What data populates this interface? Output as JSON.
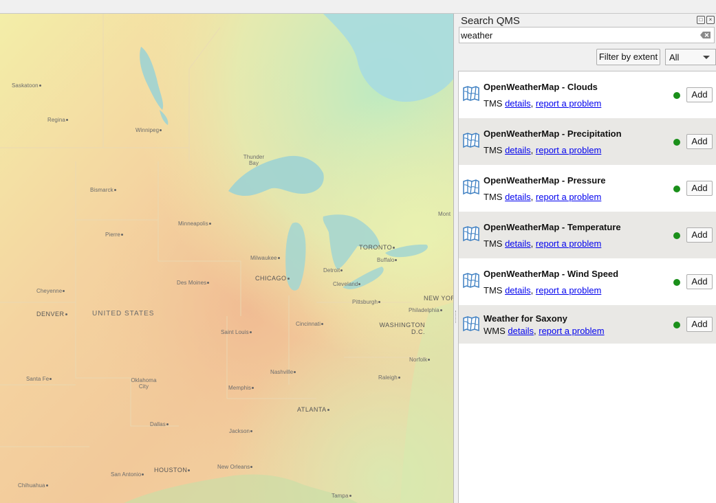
{
  "panel": {
    "title": "Search QMS",
    "search_value": "weather",
    "filter_label": "Filter by extent",
    "type_filter": "All"
  },
  "results": [
    {
      "name": "OpenWeatherMap - Clouds",
      "type": "TMS",
      "details": "details",
      "sep": ",",
      "report": "report a problem",
      "status": "ok",
      "add": "Add"
    },
    {
      "name": "OpenWeatherMap - Precipitation",
      "type": "TMS",
      "details": "details",
      "sep": ",",
      "report": "report a problem",
      "status": "ok",
      "add": "Add"
    },
    {
      "name": "OpenWeatherMap - Pressure",
      "type": "TMS",
      "details": "details",
      "sep": ",",
      "report": "report a problem",
      "status": "ok",
      "add": "Add"
    },
    {
      "name": "OpenWeatherMap - Temperature",
      "type": "TMS",
      "details": "details",
      "sep": ",",
      "report": "report a problem",
      "status": "ok",
      "add": "Add"
    },
    {
      "name": "OpenWeatherMap - Wind Speed",
      "type": "TMS",
      "details": "details",
      "sep": ",",
      "report": "report a problem",
      "status": "ok",
      "add": "Add"
    },
    {
      "name": "Weather for Saxony",
      "type": "WMS",
      "details": "details",
      "sep": ",",
      "report": "report a problem",
      "status": "ok",
      "add": "Add"
    }
  ],
  "map": {
    "labels": [
      {
        "text": "Saskatoon",
        "cls": "city"
      },
      {
        "text": "Regina",
        "cls": "city"
      },
      {
        "text": "Winnipeg",
        "cls": "city"
      },
      {
        "text": "Thunder Bay",
        "cls": "city"
      },
      {
        "text": "Bismarck",
        "cls": "city"
      },
      {
        "text": "Pierre",
        "cls": "city"
      },
      {
        "text": "Minneapolis",
        "cls": "city"
      },
      {
        "text": "Milwaukee",
        "cls": "city"
      },
      {
        "text": "CHICAGO",
        "cls": "big"
      },
      {
        "text": "Detroit",
        "cls": "city"
      },
      {
        "text": "TORONTO",
        "cls": "big"
      },
      {
        "text": "Buffalo",
        "cls": "city"
      },
      {
        "text": "Mont",
        "cls": "city"
      },
      {
        "text": "Cleveland",
        "cls": "city"
      },
      {
        "text": "Pittsburgh",
        "cls": "city"
      },
      {
        "text": "NEW YOR",
        "cls": "big"
      },
      {
        "text": "Philadelphia",
        "cls": "city"
      },
      {
        "text": "Cheyenne",
        "cls": "city"
      },
      {
        "text": "Des Moines",
        "cls": "city"
      },
      {
        "text": "DENVER",
        "cls": "big"
      },
      {
        "text": "UNITED STATES",
        "cls": "country"
      },
      {
        "text": "Cincinnati",
        "cls": "city"
      },
      {
        "text": "WASHINGTON D.C.",
        "cls": "big"
      },
      {
        "text": "Saint Louis",
        "cls": "city"
      },
      {
        "text": "Norfolk",
        "cls": "city"
      },
      {
        "text": "Nashville",
        "cls": "city"
      },
      {
        "text": "Raleigh",
        "cls": "city"
      },
      {
        "text": "Santa Fe",
        "cls": "city"
      },
      {
        "text": "Oklahoma City",
        "cls": "city"
      },
      {
        "text": "Memphis",
        "cls": "city"
      },
      {
        "text": "ATLANTA",
        "cls": "big"
      },
      {
        "text": "Dallas",
        "cls": "city"
      },
      {
        "text": "Jackson",
        "cls": "city"
      },
      {
        "text": "HOUSTON",
        "cls": "big"
      },
      {
        "text": "New Orleans",
        "cls": "city"
      },
      {
        "text": "San Antonio",
        "cls": "city"
      },
      {
        "text": "Chihuahua",
        "cls": "city"
      },
      {
        "text": "Tampa",
        "cls": "city"
      }
    ]
  }
}
